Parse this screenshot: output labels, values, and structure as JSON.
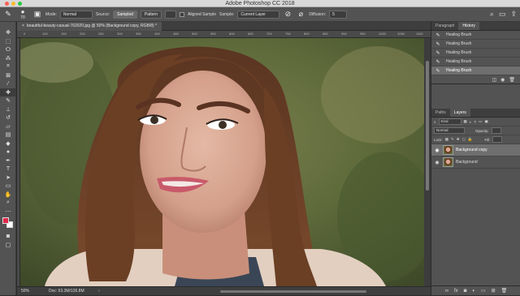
{
  "window": {
    "title": "Adobe Photoshop CC 2018"
  },
  "options_bar": {
    "mode_label": "Mode:",
    "mode_value": "Normal",
    "source_label": "Source:",
    "sampled_button": "Sampled",
    "pattern_button": "Pattern",
    "aligned_sample_label": "Aligned Sample",
    "sample_label": "Sample:",
    "sample_value": "Current Layer",
    "diffusion_label": "Diffusion:",
    "diffusion_value": "5",
    "brush_size": "70"
  },
  "document": {
    "tab_label": "beautiful-beauty-casual-762020.jpg @ 50% (Background copy, RGB/8) *",
    "ruler_ticks": [
      "0",
      "100",
      "150",
      "200",
      "250",
      "300",
      "350",
      "400",
      "450",
      "500",
      "550",
      "600",
      "650",
      "700",
      "750",
      "800",
      "850",
      "900",
      "950",
      "1000",
      "1050",
      "1100"
    ]
  },
  "status_bar": {
    "zoom": "50%",
    "doc_info": "Doc: 63.3M/126.8M",
    "scroll_position": 0.5
  },
  "panels": {
    "top_tabs": [
      "Paragraph",
      "History"
    ],
    "top_active": "History",
    "history_items": [
      "Healing Brush",
      "Healing Brush",
      "Healing Brush",
      "Healing Brush",
      "Healing Brush"
    ],
    "bottom_tabs": [
      "Paths",
      "Layers"
    ],
    "bottom_active": "Layers",
    "kind_label": "Kind",
    "blend_mode": "Normal",
    "opacity_label": "Opacity:",
    "lock_label": "Lock:",
    "fill_label": "Fill:",
    "layers": [
      {
        "name": "Background copy",
        "selected": true
      },
      {
        "name": "Background",
        "selected": false
      }
    ]
  },
  "colors": {
    "foreground": "#e0284a",
    "background": "#ffffff",
    "accent": "#6f6f6f"
  },
  "icons": {
    "history_item": "brush-icon",
    "visibility": "eye-icon"
  }
}
